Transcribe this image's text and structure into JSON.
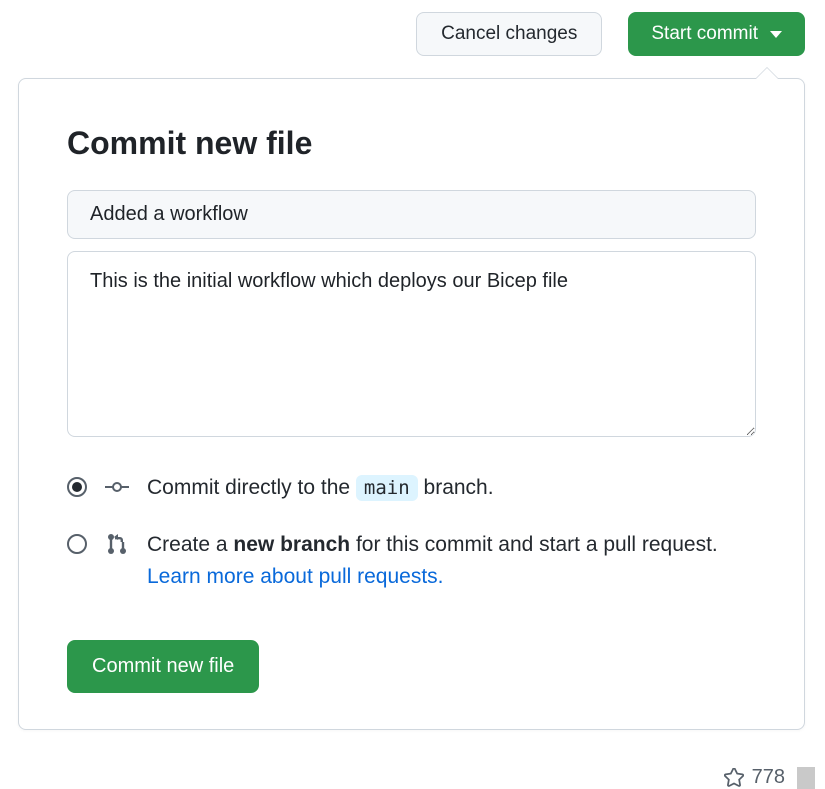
{
  "toolbar": {
    "cancel_label": "Cancel changes",
    "start_commit_label": "Start commit"
  },
  "popover": {
    "title": "Commit new file",
    "commit_summary_value": "Added a workflow",
    "commit_description_value": "This is the initial workflow which deploys our Bicep file",
    "radio": {
      "direct_prefix": "Commit directly to the ",
      "direct_branch": "main",
      "direct_suffix": " branch.",
      "new_branch_prefix": "Create a ",
      "new_branch_strong": "new branch",
      "new_branch_middle": " for this commit and start a pull request. ",
      "pr_link": "Learn more about pull requests."
    },
    "commit_button_label": "Commit new file"
  },
  "footer": {
    "star_count": "778"
  }
}
